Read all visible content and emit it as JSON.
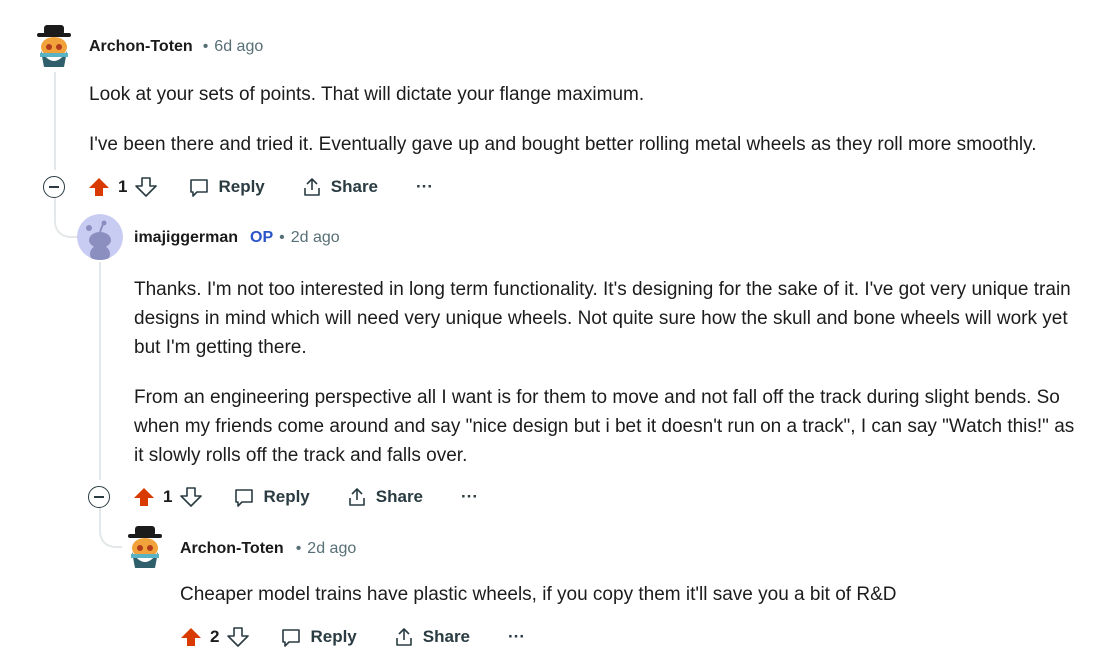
{
  "comments": [
    {
      "author": "Archon-Toten",
      "badge": "",
      "sep": "•",
      "time": "6d ago",
      "paragraphs": [
        "Look at your sets of points. That will dictate your flange maximum.",
        "I've been there and tried it. Eventually gave up and bought better rolling metal wheels as they roll more smoothly."
      ],
      "votes": "1",
      "reply_label": "Reply",
      "share_label": "Share",
      "more_label": "···"
    },
    {
      "author": "imajiggerman",
      "badge": "OP",
      "sep": "•",
      "time": "2d ago",
      "paragraphs": [
        "Thanks. I'm not too interested in long term functionality. It's designing for the sake of it. I've got very unique train designs in mind which will need very unique wheels. Not quite sure how the skull and bone wheels will work yet but I'm getting there.",
        "From an engineering perspective all I want is for them to move and not fall off the track during slight bends. So when my friends come around and say \"nice design but i bet it doesn't run on a track\", I can say \"Watch this!\" as it slowly rolls off the track and falls over."
      ],
      "votes": "1",
      "reply_label": "Reply",
      "share_label": "Share",
      "more_label": "···"
    },
    {
      "author": "Archon-Toten",
      "badge": "",
      "sep": "•",
      "time": "2d ago",
      "paragraphs": [
        "Cheaper model trains have plastic wheels, if you copy them it'll save you a bit of R&D"
      ],
      "votes": "2",
      "reply_label": "Reply",
      "share_label": "Share",
      "more_label": "···"
    }
  ],
  "colors": {
    "upvote": "#d93a00",
    "op_badge": "#2a55c7",
    "meta": "#576f76",
    "thread_line": "#e4e8ea"
  },
  "icons": [
    "collapse-icon",
    "upvote-icon",
    "downvote-icon",
    "comment-icon",
    "share-icon",
    "more-icon",
    "avatar-icon"
  ]
}
